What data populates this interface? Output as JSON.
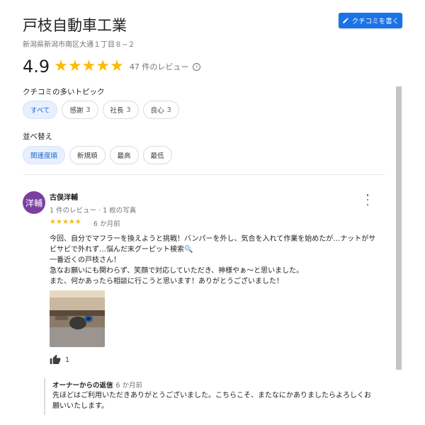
{
  "business": {
    "name": "戸枝自動車工業",
    "address": "新潟県新潟市南区大通１丁目８−２",
    "write_review_label": "クチコミを書く"
  },
  "rating": {
    "value": "4.9",
    "stars": 5,
    "count_label": "47 件のレビュー",
    "info_icon": "i"
  },
  "topics": {
    "label": "クチコミの多いトピック",
    "chips": [
      {
        "label": "すべて",
        "count": "",
        "active": true
      },
      {
        "label": "感謝",
        "count": "3",
        "active": false
      },
      {
        "label": "社長",
        "count": "3",
        "active": false
      },
      {
        "label": "良心",
        "count": "3",
        "active": false
      }
    ]
  },
  "sort": {
    "label": "並べ替え",
    "chips": [
      {
        "label": "関連度順",
        "active": true
      },
      {
        "label": "新規順",
        "active": false
      },
      {
        "label": "最高",
        "active": false
      },
      {
        "label": "最低",
        "active": false
      }
    ]
  },
  "review": {
    "avatar_text": "洋輔",
    "avatar_color": "#7b3fa0",
    "reviewer": "古俣洋輔",
    "meta": "1 件のレビュー · 1 枚の写真",
    "stars": 5,
    "time": "6 か月前",
    "text_lines": [
      "今回、自分でマフラーを換えようと挑戦！バンパーを外し、気合を入れて作業を始めたが…ナットがサ",
      "ビサビで外れず…悩んだ末グーピット検索🔍",
      "一番近くの戸枝さん！",
      "急なお願いにも関わらず、笑顔で対応していただき、神様やぁ〜と思いました。",
      "また、何かあったら相談に行こうと思います！ありがとうございました！"
    ],
    "like_count": "1"
  },
  "owner_reply": {
    "title": "オーナーからの返信",
    "time": "6 か月前",
    "text_lines": [
      "先ほどはご利用いただきありがとうございました。こちらこそ、またなにかありましたらよろしくお",
      "願いいたします。"
    ]
  },
  "colors": {
    "accent": "#1a73e8",
    "star": "#fbbc04",
    "chip_active_bg": "#e8f0fe"
  }
}
